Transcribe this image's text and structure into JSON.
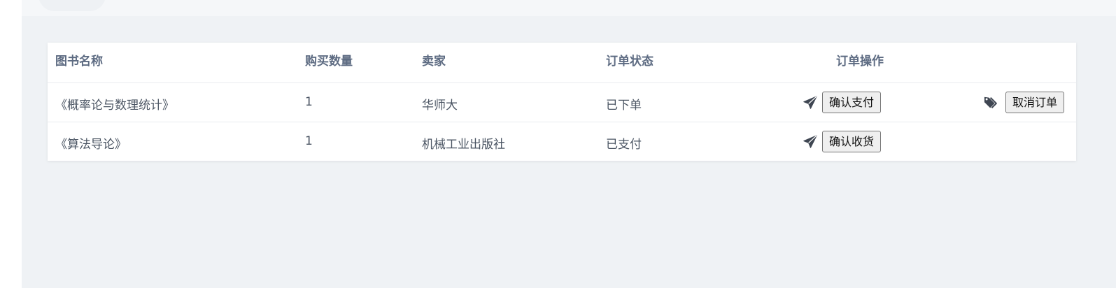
{
  "table": {
    "headers": {
      "book_name": "图书名称",
      "quantity": "购买数量",
      "seller": "卖家",
      "status": "订单状态",
      "operation": "订单操作"
    },
    "rows": [
      {
        "book_name": "《概率论与数理统计》",
        "quantity": "1",
        "seller": "华师大",
        "status": "已下单",
        "primary_action": "确认支付",
        "secondary_action": "取消订单"
      },
      {
        "book_name": "《算法导论》",
        "quantity": "1",
        "seller": "机械工业出版社",
        "status": "已支付",
        "primary_action": "确认收货"
      }
    ]
  },
  "icons": {
    "primary_action_icon": "paper-plane-icon",
    "secondary_action_icon": "tags-icon"
  },
  "colors": {
    "page_background": "#eff2f5",
    "header_text": "#5d6b82",
    "cell_text": "#4b5563",
    "icon": "#3f4652"
  }
}
